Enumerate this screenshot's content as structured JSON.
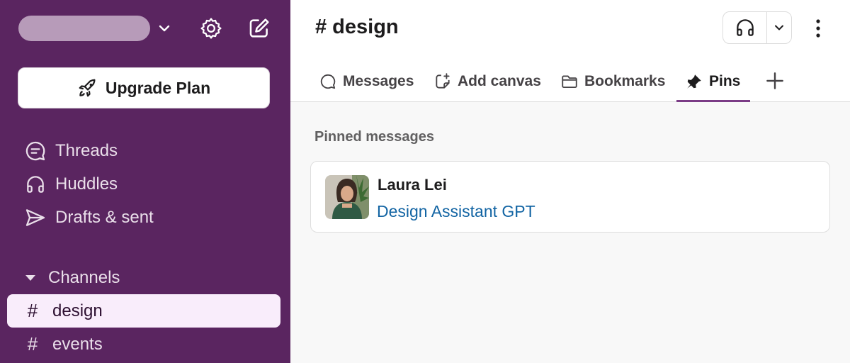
{
  "sidebar": {
    "upgrade_label": "Upgrade Plan",
    "nav": [
      {
        "label": "Threads",
        "icon": "threads-icon"
      },
      {
        "label": "Huddles",
        "icon": "headphones-icon"
      },
      {
        "label": "Drafts & sent",
        "icon": "send-icon"
      }
    ],
    "channels_heading": "Channels",
    "channels": [
      {
        "name": "design",
        "active": true
      },
      {
        "name": "events",
        "active": false
      }
    ]
  },
  "header": {
    "channel_title": "# design",
    "tabs": [
      {
        "label": "Messages",
        "icon": "message-icon",
        "active": false
      },
      {
        "label": "Add canvas",
        "icon": "canvas-icon",
        "active": false
      },
      {
        "label": "Bookmarks",
        "icon": "folder-icon",
        "active": false
      },
      {
        "label": "Pins",
        "icon": "pin-icon",
        "active": true
      }
    ]
  },
  "main": {
    "pinned_heading": "Pinned messages",
    "pins": [
      {
        "author": "Laura Lei",
        "text": "Design Assistant GPT"
      }
    ]
  },
  "colors": {
    "sidebar_bg": "#5a2560",
    "active_channel_bg": "#f9edfb",
    "tab_underline": "#7b3c86",
    "link": "#1264a3"
  }
}
